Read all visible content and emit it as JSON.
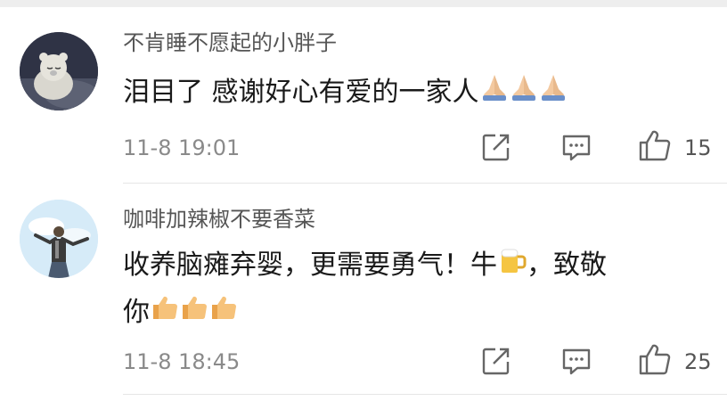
{
  "comments": [
    {
      "username": "不肯睡不愿起的小胖子",
      "text": "泪目了 感谢好心有爱的一家人",
      "emojis": [
        "folded-hands-emoji",
        "folded-hands-emoji",
        "folded-hands-emoji"
      ],
      "time": "11-8 19:01",
      "likes": "15",
      "avatar_icon": "sleeping-bear-avatar"
    },
    {
      "username": "咖啡加辣椒不要香菜",
      "text_line1": "收养脑瘫弃婴，更需要勇气！牛",
      "text_line1_suffix": "，致敬",
      "text_line2": "你",
      "inline_emoji": "beer-mug-emoji",
      "emojis": [
        "thumbs-up-emoji",
        "thumbs-up-emoji",
        "thumbs-up-emoji"
      ],
      "time": "11-8 18:45",
      "likes": "25",
      "avatar_icon": "person-in-sky-avatar"
    }
  ],
  "icons": {
    "share": "share-icon",
    "comment": "comment-icon",
    "like": "thumbs-up-icon"
  },
  "colors": {
    "username": "#555555",
    "text": "#1a1a1a",
    "time": "#8a8a8a",
    "icon": "#666666"
  }
}
